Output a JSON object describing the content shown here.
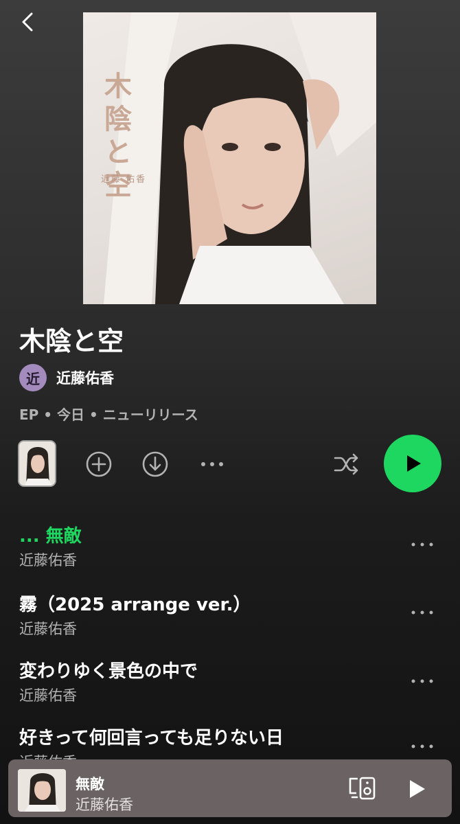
{
  "nav": {
    "back_icon": "chevron-left-icon"
  },
  "album": {
    "cover_title": "木陰と空",
    "cover_artist": "近藤 佑香",
    "title": "木陰と空",
    "artist_initial": "近",
    "artist": "近藤佑香",
    "meta": "EP • 今日 • ニューリリース"
  },
  "actions": {
    "add_icon": "plus-circle-icon",
    "download_icon": "download-circle-icon",
    "more_icon": "more-horizontal-icon",
    "shuffle_icon": "shuffle-icon",
    "play_icon": "play-icon"
  },
  "tracks": [
    {
      "title": "... 無敵",
      "artist": "近藤佑香",
      "now_playing": true
    },
    {
      "title": "霧（2025 arrange ver.）",
      "artist": "近藤佑香",
      "now_playing": false
    },
    {
      "title": "変わりゆく景色の中で",
      "artist": "近藤佑香",
      "now_playing": false
    },
    {
      "title": "好きって何回言っても足りない日",
      "artist": "近藤佑香",
      "now_playing": false
    }
  ],
  "now_playing": {
    "title": "無敵",
    "artist": "近藤佑香",
    "devices_icon": "connect-device-icon",
    "play_icon": "play-icon"
  },
  "colors": {
    "accent": "#1ed760",
    "mini_player_bg": "#6b6363",
    "secondary_text": "#b3b3b3",
    "artist_avatar": "#a48bbd"
  }
}
